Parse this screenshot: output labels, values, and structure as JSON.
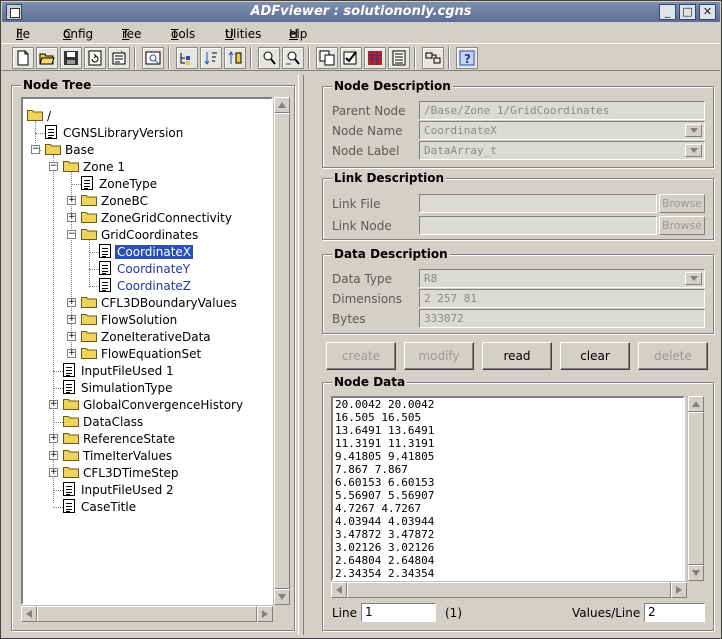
{
  "window": {
    "title": "ADFviewer : solutiononly.cgns"
  },
  "menu": [
    {
      "label": "File",
      "ul": "F",
      "rest": "ile"
    },
    {
      "label": "Config",
      "ul": "C",
      "rest": "onfig"
    },
    {
      "label": "Tree",
      "ul": "T",
      "rest": "ree"
    },
    {
      "label": "Tools",
      "ul": "T",
      "rest": "ools"
    },
    {
      "label": "Utilities",
      "ul": "U",
      "rest": "tilities"
    },
    {
      "label": "Help",
      "ul": "H",
      "rest": "elp"
    }
  ],
  "toolbar": [
    "new-file-icon",
    "open-folder-icon",
    "save-icon",
    "reload-icon",
    "properties-icon",
    "view-file-icon",
    "tree-expand-icon",
    "tree-sort-icon",
    "tree-order-icon",
    "find-icon",
    "find-next-icon",
    "copy-node-icon",
    "check-icon",
    "data-grid-icon",
    "list-icon",
    "link-icon",
    "help-icon"
  ],
  "node_tree": {
    "title": "Node Tree",
    "nodes": [
      {
        "label": "/"
      },
      {
        "label": "CGNSLibraryVersion"
      },
      {
        "label": "Base"
      },
      {
        "label": "Zone   1"
      },
      {
        "label": "ZoneType"
      },
      {
        "label": "ZoneBC"
      },
      {
        "label": "ZoneGridConnectivity"
      },
      {
        "label": "GridCoordinates"
      },
      {
        "label": "CoordinateX"
      },
      {
        "label": "CoordinateY"
      },
      {
        "label": "CoordinateZ"
      },
      {
        "label": "CFL3DBoundaryValues"
      },
      {
        "label": "FlowSolution"
      },
      {
        "label": "ZoneIterativeData"
      },
      {
        "label": "FlowEquationSet"
      },
      {
        "label": "InputFileUsed 1"
      },
      {
        "label": "SimulationType"
      },
      {
        "label": "GlobalConvergenceHistory"
      },
      {
        "label": "DataClass"
      },
      {
        "label": "ReferenceState"
      },
      {
        "label": "TimeIterValues"
      },
      {
        "label": "CFL3DTimeStep"
      },
      {
        "label": "InputFileUsed 2"
      },
      {
        "label": "CaseTitle"
      }
    ]
  },
  "node_description": {
    "title": "Node Description",
    "parent_node_label": "Parent Node",
    "parent_node_value": "/Base/Zone   1/GridCoordinates",
    "node_name_label": "Node Name",
    "node_name_value": "CoordinateX",
    "node_label_label": "Node Label",
    "node_label_value": "DataArray_t"
  },
  "link_description": {
    "title": "Link Description",
    "link_file_label": "Link File",
    "link_file_value": "",
    "link_node_label": "Link Node",
    "link_node_value": "",
    "browse_label": "Browse"
  },
  "data_description": {
    "title": "Data Description",
    "data_type_label": "Data Type",
    "data_type_value": "R8",
    "dimensions_label": "Dimensions",
    "dimensions_value": "2 257 81",
    "bytes_label": "Bytes",
    "bytes_value": "333072"
  },
  "actions": {
    "create": "create",
    "modify": "modify",
    "read": "read",
    "clear": "clear",
    "delete": "delete"
  },
  "node_data": {
    "title": "Node Data",
    "rows": [
      "20.0042 20.0042",
      "16.505 16.505",
      "13.6491 13.6491",
      "11.3191 11.3191",
      "9.41805 9.41805",
      "7.867 7.867",
      "6.60153 6.60153",
      "5.56907 5.56907",
      "4.7267 4.7267",
      "4.03944 4.03944",
      "3.47872 3.47872",
      "3.02126 3.02126",
      "2.64804 2.64804",
      "2.34354 2.34354"
    ],
    "line_label": "Line",
    "line_value": "1",
    "line_count": "(1)",
    "values_per_line_label": "Values/Line",
    "values_per_line_value": "2"
  }
}
